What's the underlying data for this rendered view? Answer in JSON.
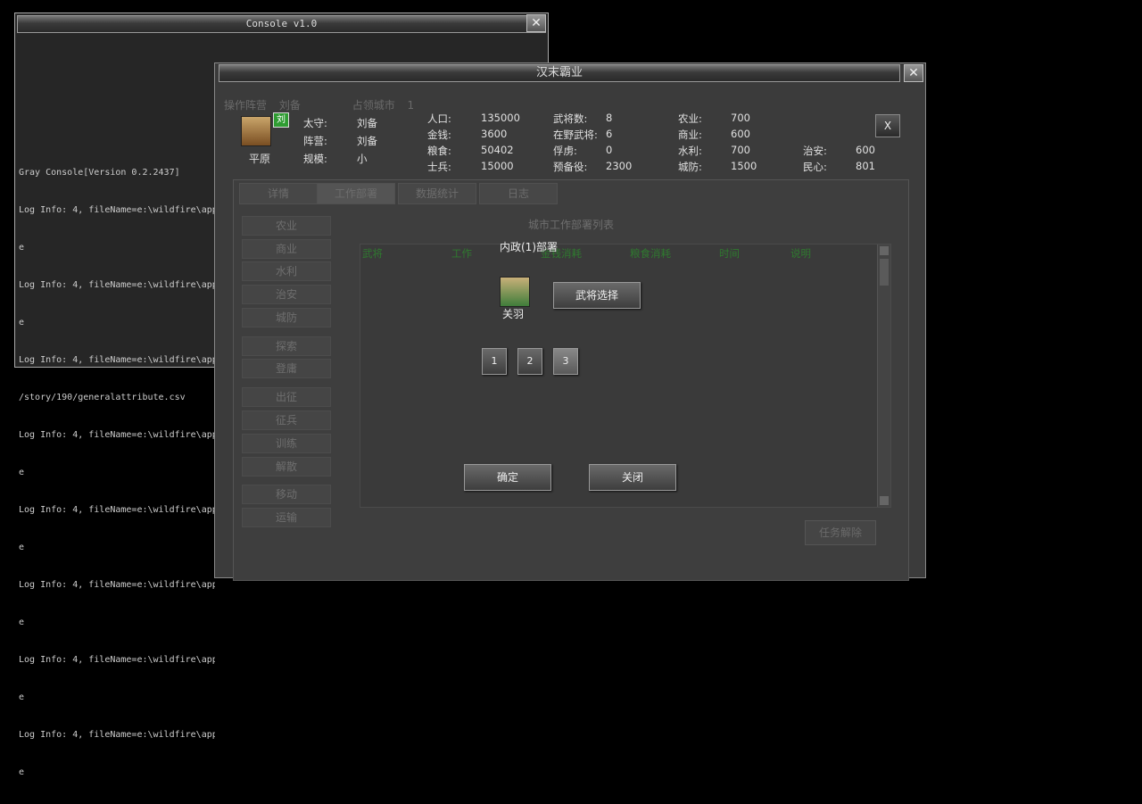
{
  "console": {
    "title": "Console v1.0",
    "version_line": "Gray Console[Version 0.2.2437]",
    "log_lines": [
      "Log Info: 4, fileName=e:\\wildfire\\app",
      "e",
      "Log Info: 4, fileName=e:\\wildfire\\app",
      "e",
      "Log Info: 4, fileName=e:\\wildfire\\app",
      "/story/190/generalattribute.csv",
      "Log Info: 4, fileName=e:\\wildfire\\app",
      "e",
      "Log Info: 4, fileName=e:\\wildfire\\app",
      "e",
      "Log Info: 4, fileName=e:\\wildfire\\app",
      "e",
      "Log Info: 4, fileName=e:\\wildfire\\app",
      "e",
      "Log Info: 4, fileName=e:\\wildfire\\app",
      "e"
    ]
  },
  "game": {
    "title": "汉末霸业",
    "bg_status": {
      "camp_label": "操作阵营",
      "camp_value": "刘备",
      "cities_label": "占领城市",
      "cities_value": "1"
    },
    "city": {
      "name": "平原",
      "badge": "刘",
      "governor_label": "太守:",
      "governor": "刘备",
      "faction_label": "阵营:",
      "faction": "刘备",
      "scale_label": "规模:",
      "scale": "小"
    },
    "stats": [
      {
        "label": "人口:",
        "value": "135000"
      },
      {
        "label": "金钱:",
        "value": "3600"
      },
      {
        "label": "粮食:",
        "value": "50402"
      },
      {
        "label": "士兵:",
        "value": "15000"
      },
      {
        "label": "武将数:",
        "value": "8"
      },
      {
        "label": "在野武将:",
        "value": "6"
      },
      {
        "label": "俘虏:",
        "value": "0"
      },
      {
        "label": "预备役:",
        "value": "2300"
      },
      {
        "label": "农业:",
        "value": "700"
      },
      {
        "label": "商业:",
        "value": "600"
      },
      {
        "label": "水利:",
        "value": "700"
      },
      {
        "label": "城防:",
        "value": "1500"
      },
      {
        "label": "治安:",
        "value": "600"
      },
      {
        "label": "民心:",
        "value": "801"
      }
    ],
    "close_label": "X",
    "tabs": [
      "详情",
      "工作部署",
      "数据统计",
      "日志"
    ],
    "sidebar": [
      "农业",
      "商业",
      "水利",
      "治安",
      "城防",
      "探索",
      "登庸",
      "出征",
      "征兵",
      "训练",
      "解散",
      "移动",
      "运输"
    ],
    "list_title": "城市工作部署列表",
    "columns": [
      "武将",
      "工作",
      "金钱消耗",
      "粮食消耗",
      "时间",
      "说明"
    ],
    "dismiss_label": "任务解除"
  },
  "dialog": {
    "title": "内政(1)部署",
    "general_name": "关羽",
    "select_button": "武将选择",
    "pages": [
      "1",
      "2",
      "3"
    ],
    "active_page": "3",
    "confirm": "确定",
    "close": "关闭"
  }
}
